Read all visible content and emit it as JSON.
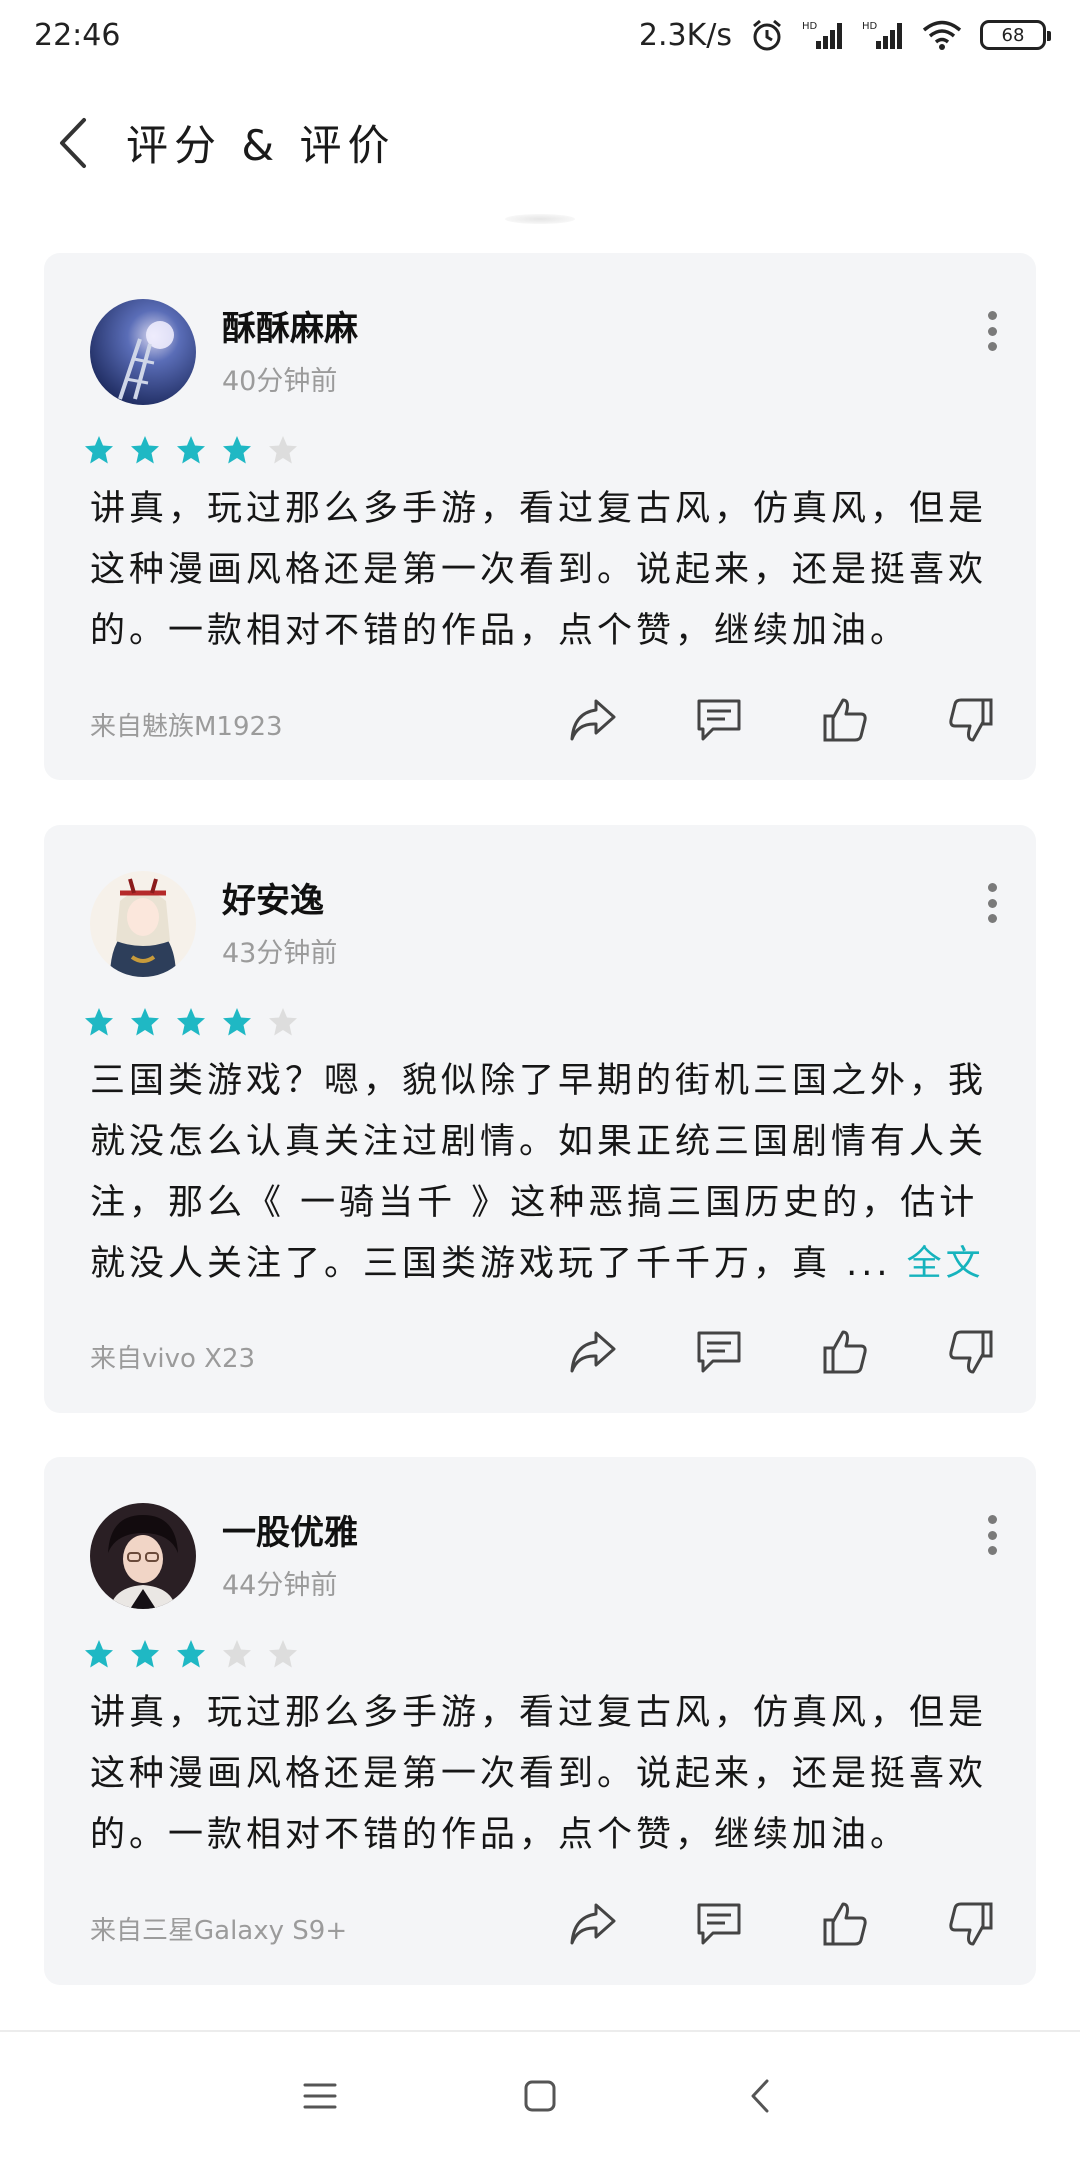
{
  "status_bar": {
    "time": "22:46",
    "net_speed": "2.3K/s",
    "battery": "68"
  },
  "header": {
    "title": "评分 & 评价"
  },
  "colors": {
    "accent": "#16b3bd",
    "star_on": "#1fb8c4",
    "star_off": "#dddddd",
    "card_bg": "#f4f5f7"
  },
  "reviews": [
    {
      "name": "酥酥麻麻",
      "time": "40分钟前",
      "rating": 4,
      "text": "讲真，玩过那么多手游，看过复古风，仿真风，但是这种漫画风格还是第一次看到。说起来，还是挺喜欢的。一款相对不错的作品，点个赞，继续加油。",
      "full_link": "",
      "device": "来自魅族M1923"
    },
    {
      "name": "好安逸",
      "time": "43分钟前",
      "rating": 4,
      "text": "三国类游戏？嗯，貌似除了早期的街机三国之外，我就没怎么认真关注过剧情。如果正统三国剧情有人关注，那么《 一骑当千 》这种恶搞三国历史的，估计就没人关注了。三国类游戏玩了千千万，真 ... ",
      "full_link": "全文",
      "device": "来自vivo X23"
    },
    {
      "name": "一股优雅",
      "time": "44分钟前",
      "rating": 3,
      "text": "讲真，玩过那么多手游，看过复古风，仿真风，但是这种漫画风格还是第一次看到。说起来，还是挺喜欢的。一款相对不错的作品，点个赞，继续加油。",
      "full_link": "",
      "device": "来自三星Galaxy S9+"
    }
  ]
}
